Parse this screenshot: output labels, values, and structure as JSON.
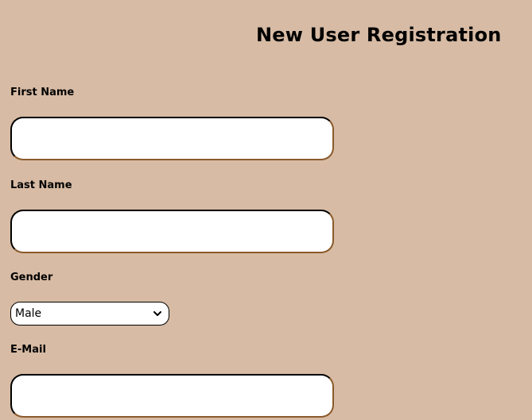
{
  "page": {
    "title": "New User Registration"
  },
  "form": {
    "first_name": {
      "label": "First Name",
      "value": ""
    },
    "last_name": {
      "label": "Last Name",
      "value": ""
    },
    "gender": {
      "label": "Gender",
      "selected": "Male"
    },
    "email": {
      "label": "E-Mail",
      "value": ""
    }
  },
  "icons": {
    "gender_dropdown": "chevron-down-icon"
  },
  "colors": {
    "background": "#d7bba4",
    "field_background": "#ffffff",
    "field_border_dark": "#000000",
    "field_border_accent": "#8a5a2a",
    "text": "#000000"
  }
}
